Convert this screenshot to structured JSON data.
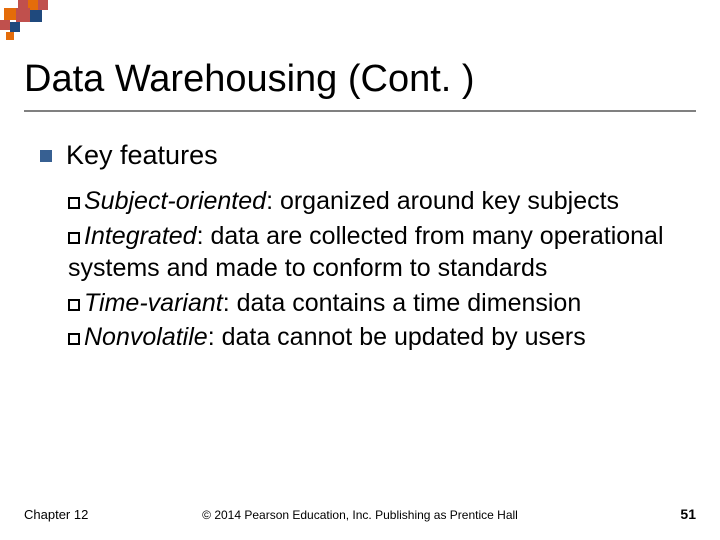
{
  "title": "Data Warehousing (Cont. )",
  "section": "Key features",
  "bullets": [
    {
      "term": "Subject-oriented",
      "desc": ": organized around key subjects"
    },
    {
      "term": "Integrated",
      "desc": ": data are collected from many operational systems and made to conform to standards"
    },
    {
      "term": "Time-variant",
      "desc": ": data contains a time dimension"
    },
    {
      "term": "Nonvolatile",
      "desc": ": data cannot be updated by users"
    }
  ],
  "footer": {
    "chapter": "Chapter 12",
    "copyright": "© 2014 Pearson Education, Inc. Publishing as Prentice Hall",
    "page": "51"
  },
  "logo_colors": {
    "red": "#C0504D",
    "orange": "#E46C0A",
    "blue": "#1F497D"
  }
}
